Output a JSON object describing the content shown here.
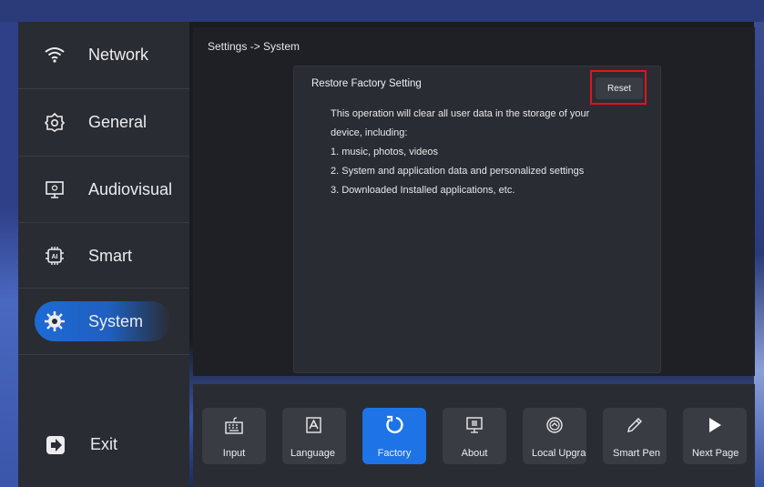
{
  "sidebar": {
    "items": [
      {
        "label": "Network",
        "icon": "wifi-icon"
      },
      {
        "label": "General",
        "icon": "gear-outline-icon"
      },
      {
        "label": "Audiovisual",
        "icon": "monitor-icon"
      },
      {
        "label": "Smart",
        "icon": "ai-chip-icon"
      },
      {
        "label": "System",
        "icon": "system-gear-icon",
        "active": true
      }
    ],
    "exit_label": "Exit"
  },
  "main": {
    "breadcrumb": "Settings -> System",
    "card": {
      "title": "Restore Factory Setting",
      "reset_label": "Reset",
      "lines": [
        "This operation will clear all user data in the storage of your",
        "device, including:",
        "1. music, photos, videos",
        "2. System and application data and personalized settings",
        "3. Downloaded Installed applications, etc."
      ]
    }
  },
  "bottombar": {
    "tiles": [
      {
        "label": "Input",
        "icon": "keyboard-icon"
      },
      {
        "label": "Language",
        "icon": "language-icon"
      },
      {
        "label": "Factory",
        "icon": "restore-icon",
        "active": true
      },
      {
        "label": "About",
        "icon": "info-screen-icon"
      },
      {
        "label": "Local Upgrade",
        "icon": "upgrade-icon"
      },
      {
        "label": "Smart Pen",
        "icon": "pen-icon"
      },
      {
        "label": "Next Page",
        "icon": "play-next-icon"
      }
    ]
  },
  "colors": {
    "accent": "#1e74e6",
    "highlight_border": "#e0141c"
  }
}
